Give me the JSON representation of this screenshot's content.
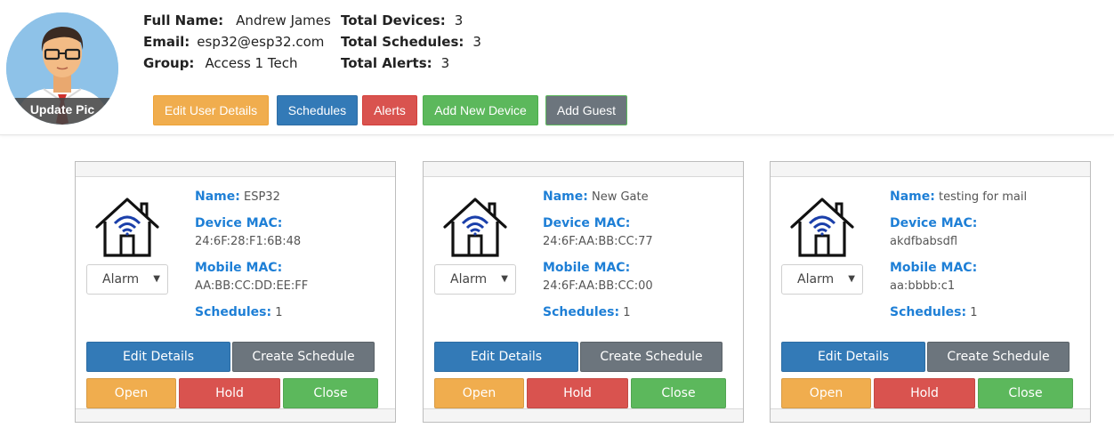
{
  "user": {
    "update_pic_label": "Update Pic",
    "full_name_label": "Full Name:",
    "full_name": "Andrew James",
    "email_label": "Email:",
    "email": "esp32@esp32.com",
    "group_label": "Group:",
    "group": "Access 1 Tech",
    "total_devices_label": "Total Devices:",
    "total_devices": "3",
    "total_schedules_label": "Total Schedules:",
    "total_schedules": "3",
    "total_alerts_label": "Total Alerts:",
    "total_alerts": "3"
  },
  "toolbar": {
    "edit_user": "Edit User Details",
    "schedules": "Schedules",
    "alerts": "Alerts",
    "add_device": "Add New Device",
    "add_guest": "Add Guest"
  },
  "labels": {
    "name": "Name:",
    "device_mac": "Device MAC:",
    "mobile_mac": "Mobile MAC:",
    "schedules": "Schedules:",
    "edit_details": "Edit Details",
    "create_schedule": "Create Schedule",
    "open": "Open",
    "hold": "Hold",
    "close": "Close"
  },
  "devices": [
    {
      "name": "ESP32",
      "device_mac": "24:6F:28:F1:6B:48",
      "mobile_mac": "AA:BB:CC:DD:EE:FF",
      "schedules": "1",
      "mode": "Alarm"
    },
    {
      "name": "New Gate",
      "device_mac": "24:6F:AA:BB:CC:77",
      "mobile_mac": "24:6F:AA:BB:CC:00",
      "schedules": "1",
      "mode": "Alarm"
    },
    {
      "name": "testing for mail",
      "device_mac": "akdfbabsdfl",
      "mobile_mac": "aa:bbbb:c1",
      "schedules": "1",
      "mode": "Alarm"
    }
  ],
  "colors": {
    "warning": "#f0ad4e",
    "primary": "#337ab7",
    "danger": "#d9534f",
    "success": "#5cb85c",
    "secondary": "#6c757d",
    "label_blue": "#1e7fd6",
    "wifi_blue": "#1a3faa"
  },
  "icons": {
    "avatar": "user-avatar-illustration",
    "device": "smart-home-wifi-icon",
    "select_caret": "caret-down-icon"
  }
}
